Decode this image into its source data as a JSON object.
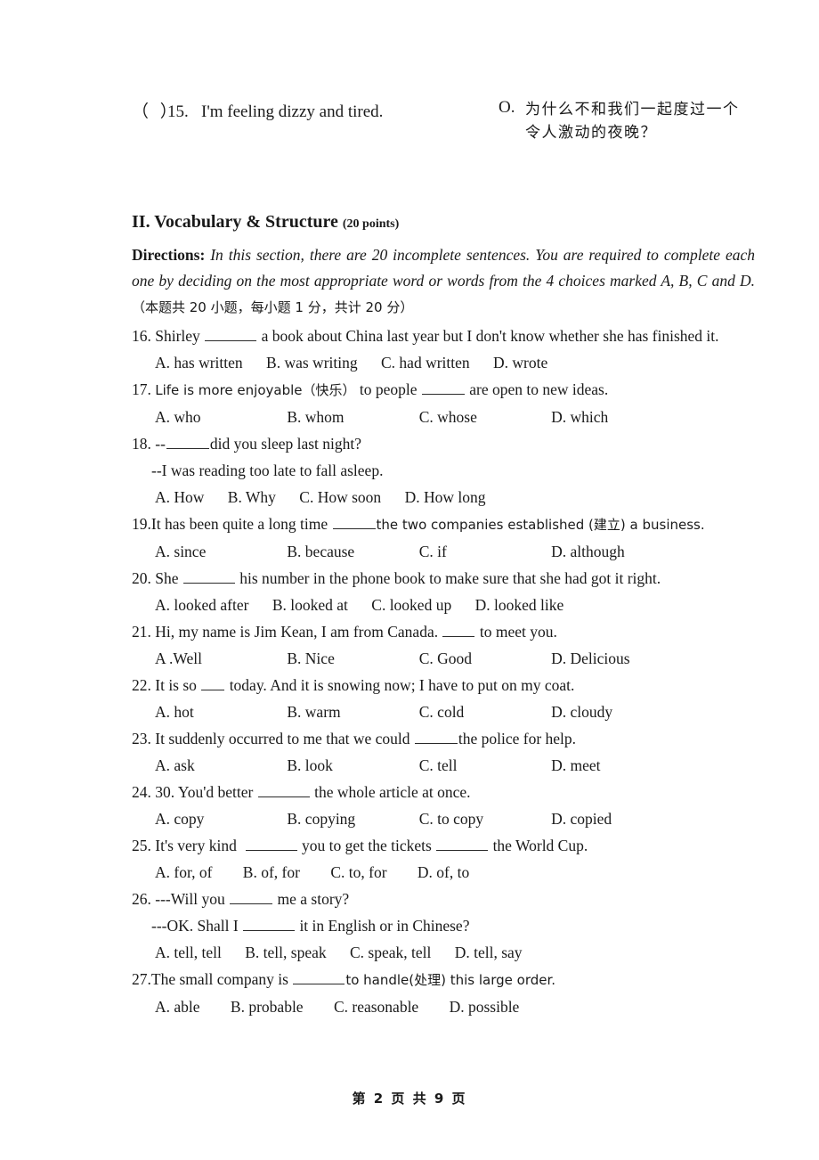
{
  "document": {
    "page_footer": "第 2 页 共 9 页"
  },
  "matching_item": {
    "checkbox_marker": "（  ）",
    "number": "15.",
    "english_text": "I'm feeling dizzy and tired.",
    "option_letter": "O.",
    "chinese_text": "为什么不和我们一起度过一个令人激动的夜晚？"
  },
  "section": {
    "heading": "II. Vocabulary & Structure",
    "points": "(20 points)",
    "directions_label": "Directions:",
    "directions_text": "In this section, there are 20 incomplete sentences. You are required to complete each one by deciding on the most appropriate word or words from the 4 choices marked A, B, C and D.",
    "directions_chinese": "（本题共 20 小题，每小题 1 分，共计 20 分）"
  },
  "questions": [
    {
      "number": "16.",
      "stem_before": "Shirley",
      "stem_after": "a book about China last year but I don't know whether she has finished it.",
      "options": [
        "A. has written",
        "B. was writing",
        "C. had written",
        "D. wrote"
      ]
    },
    {
      "number": "17.",
      "stem_before": "Life is more enjoyable（快乐）",
      "stem_after": "to people",
      "stem_tail": "are open to new ideas.",
      "options": [
        "A. who",
        "B. whom",
        "C. whose",
        "D. which"
      ]
    },
    {
      "number": "18.",
      "stem_before": "--",
      "stem_after": "did you sleep last night?",
      "sub_line": "--I was reading too late to fall asleep.",
      "options": [
        "A. How",
        "B. Why",
        "C. How soon",
        "D. How long"
      ]
    },
    {
      "number": "19.",
      "stem_before": "It has been quite a long time",
      "stem_after": "the two companies established (建立) a business.",
      "options": [
        "A. since",
        "B. because",
        "C. if",
        "D. although"
      ]
    },
    {
      "number": "20.",
      "stem_before": "She",
      "stem_after": "his number in the phone book to make sure that she had got it right.",
      "options": [
        "A. looked after",
        "B. looked at",
        "C. looked up",
        "D. looked like"
      ]
    },
    {
      "number": "21.",
      "stem_before": "Hi, my name is Jim Kean, I am from Canada.",
      "stem_after": "to meet you.",
      "options": [
        "A .Well",
        "B. Nice",
        "C. Good",
        "D. Delicious"
      ]
    },
    {
      "number": "22.",
      "stem_before": "It is so",
      "stem_after": "today. And it is snowing now; I have to put on my coat.",
      "options": [
        "A. hot",
        "B. warm",
        "C. cold",
        "D. cloudy"
      ]
    },
    {
      "number": "23.",
      "stem_before": "It suddenly occurred to me that we could",
      "stem_after": "the police for help.",
      "options": [
        "A. ask",
        "B. look",
        "C. tell",
        "D. meet"
      ]
    },
    {
      "number": "24.",
      "stem_before": "30. You'd better",
      "stem_after": "the whole article at once.",
      "options": [
        "A. copy",
        "B. copying",
        "C. to copy",
        "D. copied"
      ]
    },
    {
      "number": "25.",
      "stem_before": "It's very kind",
      "stem_after": "you to get the tickets",
      "stem_tail": "the World Cup.",
      "options": [
        "A. for, of",
        "B. of, for",
        "C. to, for",
        "D. of, to"
      ]
    },
    {
      "number": "26.",
      "stem_before": "---Will you",
      "stem_after": "me a story?",
      "sub_line_before": "---OK. Shall I",
      "sub_line_after": "it in English or in Chinese?",
      "options": [
        "A. tell, tell",
        "B. tell, speak",
        "C. speak, tell",
        "D. tell, say"
      ]
    },
    {
      "number": "27.",
      "stem_before": "The small company is",
      "stem_after": "to handle(处理) this large order.",
      "options": [
        "A. able",
        "B. probable",
        "C. reasonable",
        "D. possible"
      ]
    }
  ]
}
